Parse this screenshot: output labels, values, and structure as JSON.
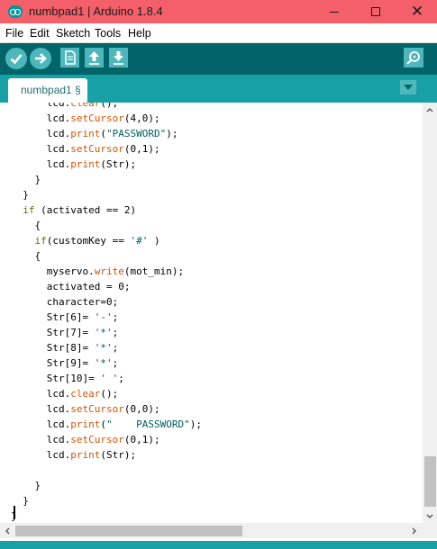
{
  "window": {
    "title": "numbpad1 | Arduino 1.8.4"
  },
  "menu": {
    "items": [
      "File",
      "Edit",
      "Sketch",
      "Tools",
      "Help"
    ]
  },
  "toolbar": {
    "buttons": [
      {
        "name": "verify-button",
        "icon": "check-icon"
      },
      {
        "name": "upload-button",
        "icon": "arrow-right-icon"
      },
      {
        "name": "new-button",
        "icon": "document-icon"
      },
      {
        "name": "open-button",
        "icon": "arrow-up-icon"
      },
      {
        "name": "save-button",
        "icon": "arrow-down-icon"
      },
      {
        "name": "serial-monitor-button",
        "icon": "magnifier-icon"
      }
    ],
    "colors": {
      "bar": "#006468",
      "button": "#4db7bb",
      "tabbar": "#17a1a5"
    }
  },
  "tab": {
    "label": "numbpad1 §"
  },
  "editor": {
    "cursor_line": 27
  }
}
